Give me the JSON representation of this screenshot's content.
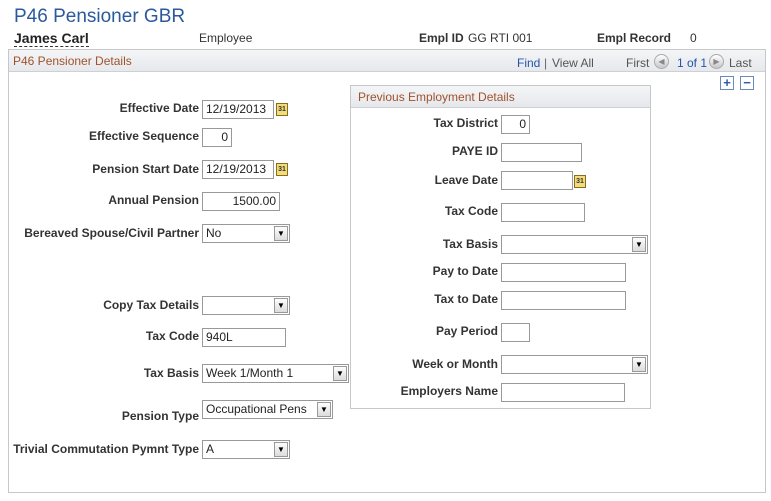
{
  "page": {
    "title": "P46 Pensioner GBR",
    "employee_name": "James Carl",
    "employee_type": "Employee",
    "empl_id_label": "Empl ID",
    "empl_id_value": "GG RTI 001",
    "empl_record_label": "Empl Record",
    "empl_record_value": "0"
  },
  "panel": {
    "title": "P46 Pensioner Details",
    "nav": {
      "find": "Find",
      "sep": "|",
      "view_all": "View All",
      "first": "First",
      "range": "1 of 1",
      "last": "Last"
    },
    "add_symbol": "+",
    "remove_symbol": "−"
  },
  "form": {
    "effective_date": {
      "label": "Effective Date",
      "value": "12/19/2013"
    },
    "effective_sequence": {
      "label": "Effective Sequence",
      "value": "0"
    },
    "pension_start_date": {
      "label": "Pension Start Date",
      "value": "12/19/2013"
    },
    "annual_pension": {
      "label": "Annual Pension",
      "value": "1500.00"
    },
    "bereaved_spouse": {
      "label": "Bereaved Spouse/Civil Partner",
      "value": "No"
    },
    "copy_tax_details": {
      "label": "Copy Tax Details",
      "value": ""
    },
    "tax_code": {
      "label": "Tax Code",
      "value": "940L"
    },
    "tax_basis": {
      "label": "Tax Basis",
      "value": "Week 1/Month 1"
    },
    "pension_type": {
      "label": "Pension Type",
      "value": "Occupational Pens"
    },
    "trivial_commutation": {
      "label": "Trivial Commutation Pymnt Type",
      "value": "A"
    }
  },
  "previous": {
    "title": "Previous Employment Details",
    "tax_district": {
      "label": "Tax District",
      "value": "0"
    },
    "paye_id": {
      "label": "PAYE ID",
      "value": ""
    },
    "leave_date": {
      "label": "Leave Date",
      "value": ""
    },
    "tax_code": {
      "label": "Tax Code",
      "value": ""
    },
    "tax_basis": {
      "label": "Tax Basis",
      "value": ""
    },
    "pay_to_date": {
      "label": "Pay to Date",
      "value": ""
    },
    "tax_to_date": {
      "label": "Tax to Date",
      "value": ""
    },
    "pay_period": {
      "label": "Pay Period",
      "value": ""
    },
    "week_or_month": {
      "label": "Week or Month",
      "value": ""
    },
    "employers_name": {
      "label": "Employers Name",
      "value": ""
    }
  },
  "icons": {
    "calendar": "31",
    "dropdown": "▼",
    "prev": "◀",
    "next": "▶"
  }
}
